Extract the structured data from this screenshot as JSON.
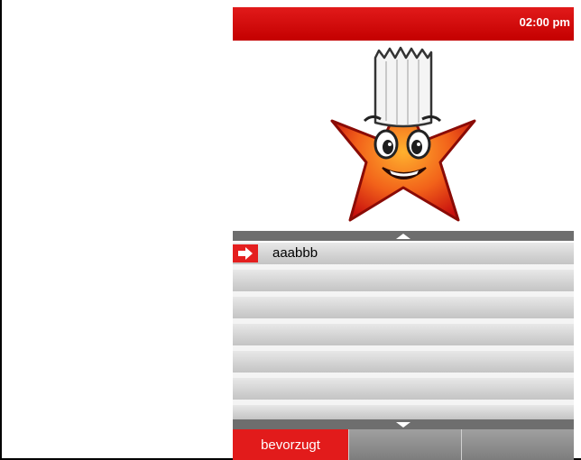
{
  "status_bar": {
    "time": "02:00 pm"
  },
  "mascot": {
    "icon": "chef-star-mascot"
  },
  "list": {
    "scroll_up_icon": "triangle-up-icon",
    "scroll_down_icon": "triangle-down-icon",
    "selected_marker_icon": "arrow-right-icon",
    "rows": [
      {
        "label": "aaabbb",
        "selected": true
      },
      {
        "label": "",
        "selected": false
      },
      {
        "label": "",
        "selected": false
      },
      {
        "label": "",
        "selected": false
      },
      {
        "label": "",
        "selected": false
      },
      {
        "label": "",
        "selected": false
      },
      {
        "label": "",
        "selected": false
      }
    ]
  },
  "tabs": [
    {
      "label": "bevorzugt",
      "active": true
    },
    {
      "label": "",
      "active": false
    },
    {
      "label": "",
      "active": false
    }
  ],
  "colors": {
    "accent": "#e21b1b",
    "scrollbar": "#6e6e6e"
  }
}
